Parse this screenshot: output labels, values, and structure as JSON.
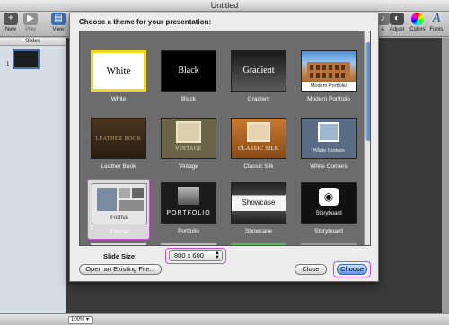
{
  "window": {
    "title": "Untitled"
  },
  "toolbar": {
    "left": [
      {
        "label": "New",
        "icon": "plus-icon"
      },
      {
        "label": "Play",
        "icon": "play-icon"
      },
      {
        "label": "View",
        "icon": "view-icon"
      }
    ],
    "right": [
      {
        "label": "a",
        "icon": "media-icon"
      },
      {
        "label": "Adjust",
        "icon": "adjust-icon"
      },
      {
        "label": "Colors",
        "icon": "colors-icon"
      },
      {
        "label": "Fonts",
        "icon": "fonts-icon"
      }
    ]
  },
  "slides_pane": {
    "header": "Slides",
    "slide_number": "1"
  },
  "status": {
    "zoom": "100%"
  },
  "sheet": {
    "title": "Choose a theme for your presentation:",
    "themes": [
      {
        "label": "White",
        "thumb_text": "White"
      },
      {
        "label": "Black",
        "thumb_text": "Black"
      },
      {
        "label": "Gradient",
        "thumb_text": "Gradient"
      },
      {
        "label": "Modern Portfolio",
        "thumb_text": "Modern Portfolio"
      },
      {
        "label": "Leather Book",
        "thumb_text": "LEATHER BOOK"
      },
      {
        "label": "Vintage",
        "thumb_text": "VINTAGE"
      },
      {
        "label": "Classic Silk",
        "thumb_text": "CLASSIC SILK"
      },
      {
        "label": "White Corners",
        "thumb_text": "White Corners"
      },
      {
        "label": "Formal",
        "thumb_text": "Formal"
      },
      {
        "label": "Portfolio",
        "thumb_text": "PORTFOLIO"
      },
      {
        "label": "Showcase",
        "thumb_text": "Showcase"
      },
      {
        "label": "Storyboard",
        "thumb_text": "Storyboard"
      }
    ],
    "slide_size_label": "Slide Size:",
    "slide_size_value": "800 x 600",
    "open_button": "Open an Existing File...",
    "close_button": "Close",
    "choose_button": "Choose"
  },
  "colors": {
    "highlight": "#c850d8",
    "accent": "#5b95e0",
    "selection_yellow": "#f2d81f"
  }
}
